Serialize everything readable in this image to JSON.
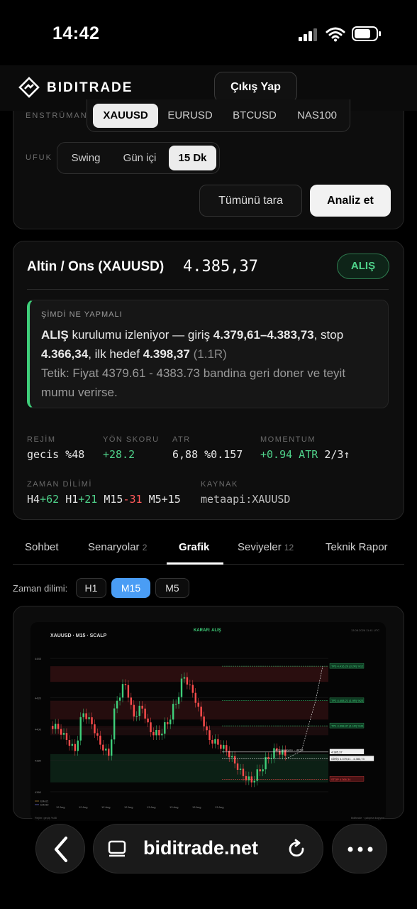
{
  "status": {
    "time": "14:42"
  },
  "brand": {
    "name": "BIDITRADE",
    "logout": "Çıkış Yap"
  },
  "instrument": {
    "label": "ENSTRÜMAN",
    "options": [
      "XAUUSD",
      "EURUSD",
      "BTCUSD",
      "NAS100"
    ],
    "selected": "XAUUSD"
  },
  "horizon": {
    "label": "UFUK",
    "options": [
      "Swing",
      "Gün içi",
      "15 Dk"
    ],
    "selected": "15 Dk"
  },
  "actions": {
    "scan_all": "Tümünü tara",
    "analyze": "Analiz et"
  },
  "summary": {
    "title": "Altin / Ons (XAUUSD)",
    "price": "4.385,37",
    "signal": "ALIŞ",
    "now_label": "ŞİMDİ NE YAPMALI",
    "line1_action": "ALIŞ",
    "line1_text": " kurulumu izleniyor — giriş ",
    "entry": "4.379,61–4.383,73",
    "stop_text": ", stop",
    "stop": "4.366,34",
    "target_text": ", ilk hedef ",
    "target": "4.398,37",
    "rr": "(1.1R)",
    "trigger": "Tetik: Fiyat 4379.61 - 4383.73 bandina geri doner ve teyit mumu verirse."
  },
  "metrics": {
    "regime": {
      "label": "REJİM",
      "value": "gecis %48"
    },
    "direction": {
      "label": "YÖN SKORU",
      "value": "+28.2"
    },
    "atr": {
      "label": "ATR",
      "value": "6,88 %0.157"
    },
    "momentum": {
      "label": "MOMENTUM",
      "value": "+0.94 ATR",
      "extra": "2/3↑"
    },
    "timeframe": {
      "label": "ZAMAN DİLİMİ",
      "h4": "H4",
      "h4v": "+62",
      "h1": "H1",
      "h1v": "+21",
      "m15": "M15",
      "m15v": "-31",
      "m5": "M5",
      "m5v": "+15"
    },
    "source": {
      "label": "KAYNAK",
      "value": "metaapi:XAUUSD"
    }
  },
  "tabs": [
    {
      "label": "Sohbet",
      "count": ""
    },
    {
      "label": "Senaryolar",
      "count": "2"
    },
    {
      "label": "Grafik",
      "count": ""
    },
    {
      "label": "Seviyeler",
      "count": "12"
    },
    {
      "label": "Teknik Rapor",
      "count": ""
    }
  ],
  "active_tab": "Grafik",
  "tf": {
    "label": "Zaman dilimi:",
    "options": [
      "H1",
      "M15",
      "M5"
    ],
    "selected": "M15"
  },
  "chart": {
    "header_left": "XAUUSD · M15 · SCALP",
    "header_center": "KARAR: ALIŞ",
    "header_right": "13.08.2026 11:41 UTC",
    "tags": {
      "tp3": "TP3 4.416,29 (3.2R) %12",
      "tp2": "TP2 4.408,21 (1.9R) %23",
      "tp1": "TP1 4.398,37 (1.1R) %43",
      "price": "4.385,37",
      "entry": "GİRİŞ 4.379,61 - 4.383,73",
      "stop": "STOP 4.366,34",
      "path": "ALIŞ senaryosu → AKTİF"
    },
    "y_ticks": [
      "4445",
      "4420",
      "4400",
      "4380",
      "4360"
    ],
    "x_ticks": [
      "12 Aug",
      "12 Aug",
      "12 Aug",
      "12 Aug",
      "13 Aug",
      "13 Aug",
      "13 Aug",
      "13 Aug"
    ],
    "legend": [
      "EMA21",
      "EMA50"
    ],
    "footer_left": "Rejim: geçiş %48",
    "footer_right": "biditrade · çalışma kopyası",
    "colors": {
      "up": "#3fcf7a",
      "down": "#ff4d4d",
      "bg": "#0a0a0a"
    }
  },
  "chart_data": {
    "type": "line",
    "title": "XAUUSD · M15 · SCALP",
    "series": [
      {
        "name": "",
        "values": [
          4402,
          4395,
          4388,
          4412,
          4405,
          4392,
          4385,
          4420,
          4430,
          4410,
          4415,
          4400,
          4398,
          4405,
          4418,
          4435,
          4425,
          4410,
          4395,
          4392,
          4388,
          4380,
          4372,
          4368,
          4375,
          4383,
          4388,
          4385
        ]
      }
    ],
    "ylim": [
      4355,
      4450
    ]
  },
  "browser": {
    "url": "biditrade.net"
  }
}
